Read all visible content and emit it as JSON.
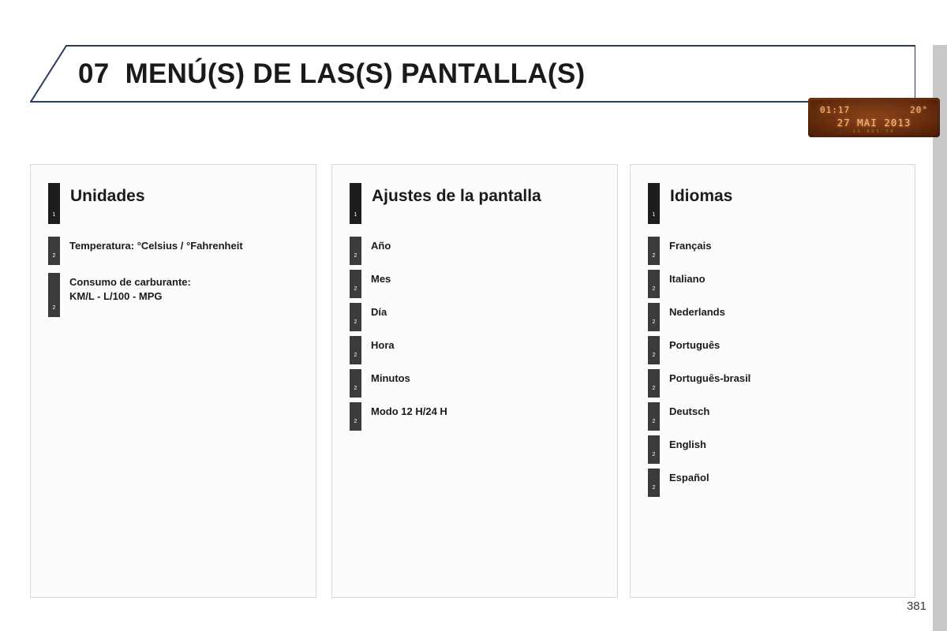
{
  "header": {
    "chapter_number": "07",
    "title": "MENÚ(S) DE LAS(S) PANTALLA(S)",
    "full_title": "07  MENÚ(S) DE LAS(S) PANTALLA(S)"
  },
  "cluster_display": {
    "time": "01:17",
    "temperature": "20°",
    "date": "27 MAI 2013",
    "sub_text": "13        RDS  TA",
    "background_color": "#6b3010",
    "text_color": "#ffbb77"
  },
  "panels": [
    {
      "title": "Unidades",
      "marker_level": "1",
      "marker_label": "1",
      "items": [
        {
          "label": "Temperatura: °Celsius / °Fahrenheit",
          "marker_label": "2",
          "tall": false
        },
        {
          "label": "Consumo de carburante:\nKM/L - L/100 - MPG",
          "marker_label": "2",
          "tall": true
        }
      ]
    },
    {
      "title": "Ajustes de la pantalla",
      "marker_level": "1",
      "marker_label": "1",
      "items": [
        {
          "label": "Año",
          "marker_label": "2",
          "tall": false
        },
        {
          "label": "Mes",
          "marker_label": "2",
          "tall": false
        },
        {
          "label": "Día",
          "marker_label": "2",
          "tall": false
        },
        {
          "label": "Hora",
          "marker_label": "2",
          "tall": false
        },
        {
          "label": "Minutos",
          "marker_label": "2",
          "tall": false
        },
        {
          "label": "Modo 12 H/24 H",
          "marker_label": "2",
          "tall": false
        }
      ]
    },
    {
      "title": "Idiomas",
      "marker_level": "1",
      "marker_label": "1",
      "items": [
        {
          "label": "Français",
          "marker_label": "2",
          "tall": false
        },
        {
          "label": "Italiano",
          "marker_label": "2",
          "tall": false
        },
        {
          "label": "Nederlands",
          "marker_label": "2",
          "tall": false
        },
        {
          "label": "Português",
          "marker_label": "2",
          "tall": false
        },
        {
          "label": "Português-brasil",
          "marker_label": "2",
          "tall": false
        },
        {
          "label": "Deutsch",
          "marker_label": "2",
          "tall": false
        },
        {
          "label": "English",
          "marker_label": "2",
          "tall": false
        },
        {
          "label": "Español",
          "marker_label": "2",
          "tall": false
        }
      ]
    }
  ],
  "footer": {
    "page_number": "381"
  },
  "colors": {
    "header_border": "#2a3c5c",
    "marker_level1": "#1d1d1d",
    "marker_level2": "#3b3b3b",
    "panel_border": "#d8d8d8",
    "edge_strip": "#c8c8c8"
  }
}
